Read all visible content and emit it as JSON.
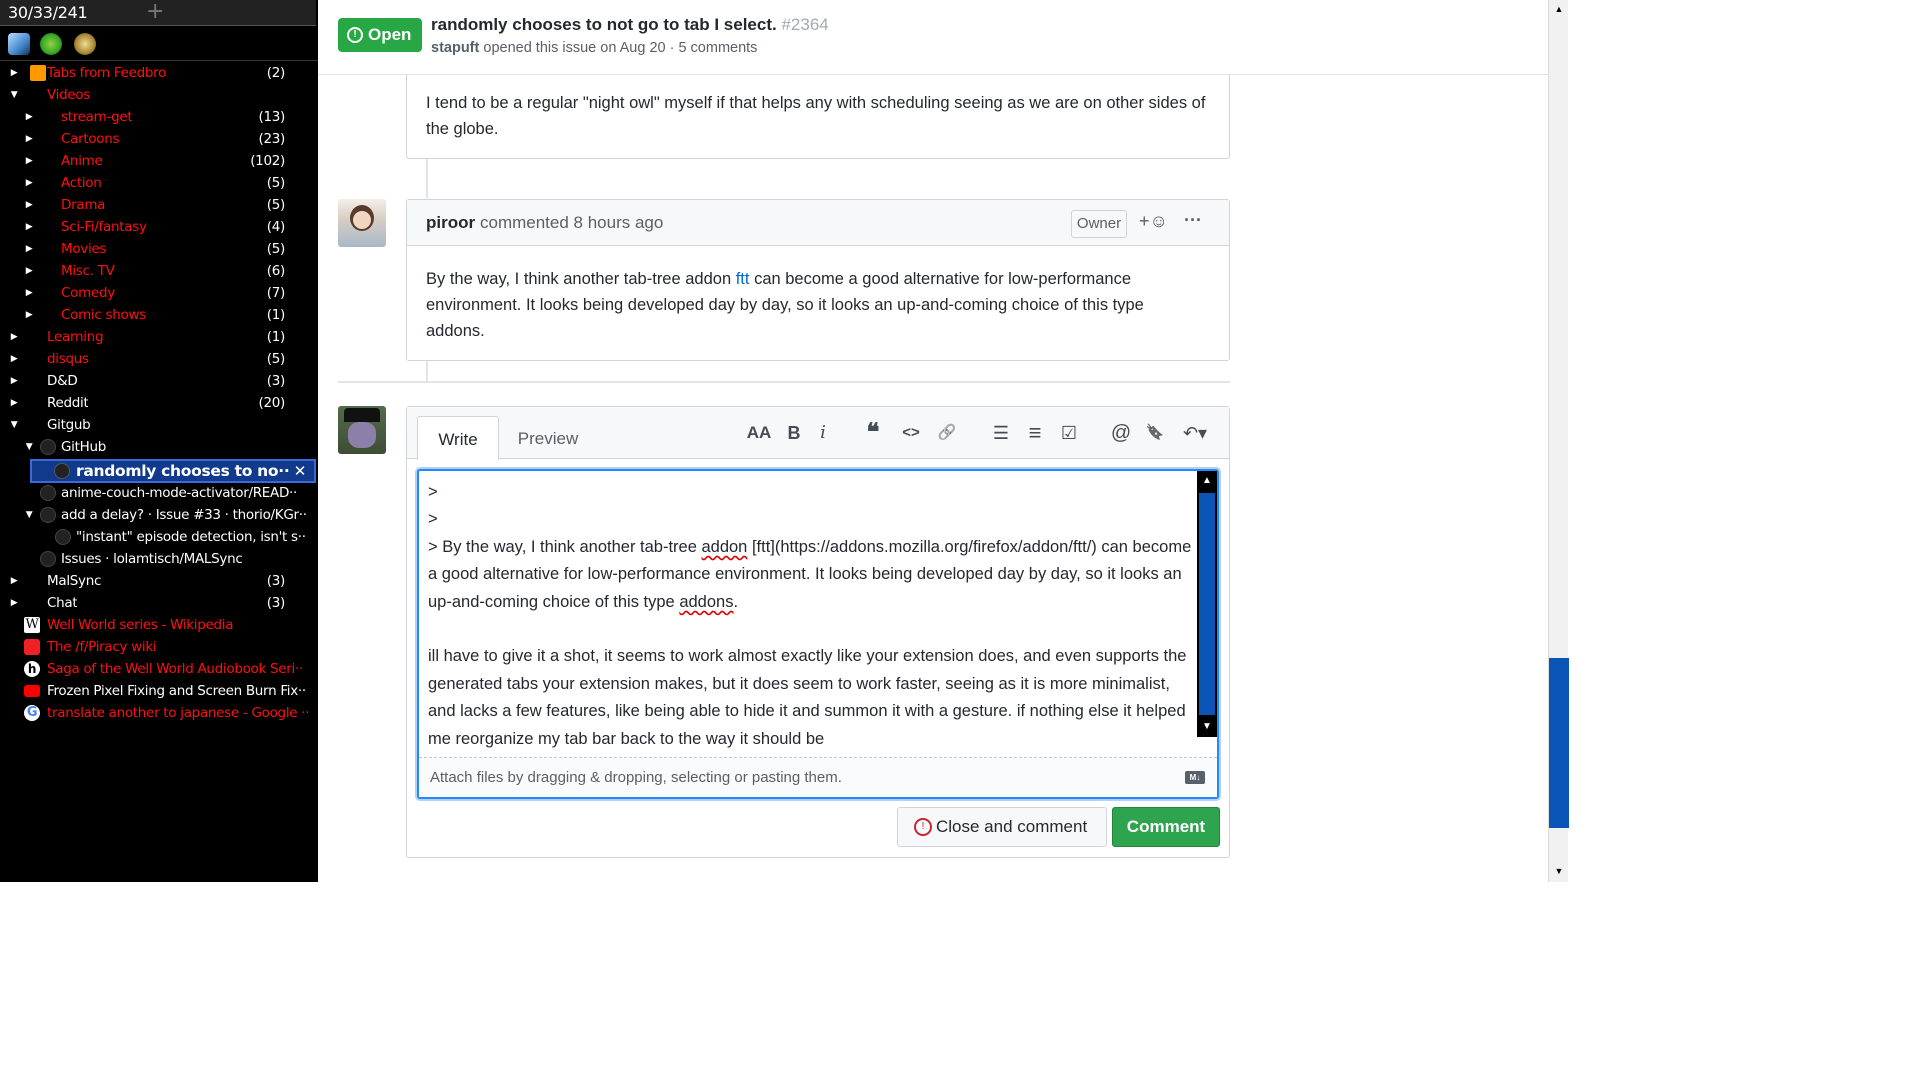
{
  "sidebar": {
    "count": "30/33/241",
    "plus": "+",
    "tree": [
      {
        "label": "Tabs from Feedbro",
        "count": "(2)"
      },
      {
        "label": "Videos",
        "count": ""
      },
      {
        "label": "stream-get",
        "count": "(13)"
      },
      {
        "label": "Cartoons",
        "count": "(23)"
      },
      {
        "label": "Anime",
        "count": "(102)"
      },
      {
        "label": "Action",
        "count": "(5)"
      },
      {
        "label": "Drama",
        "count": "(5)"
      },
      {
        "label": "Sci-Fi/fantasy",
        "count": "(4)"
      },
      {
        "label": "Movies",
        "count": "(5)"
      },
      {
        "label": "Misc. TV",
        "count": "(6)"
      },
      {
        "label": "Comedy",
        "count": "(7)"
      },
      {
        "label": "Comic shows",
        "count": "(1)"
      },
      {
        "label": "Learning",
        "count": "(1)"
      },
      {
        "label": "disqus",
        "count": "(5)"
      },
      {
        "label": "D&D",
        "count": "(3)"
      },
      {
        "label": "Reddit",
        "count": "(20)"
      },
      {
        "label": "Gitgub",
        "count": ""
      },
      {
        "label": "GitHub",
        "count": ""
      },
      {
        "label": "randomly chooses to no··",
        "count": ""
      },
      {
        "label": "anime-couch-mode-activator/READ··",
        "count": ""
      },
      {
        "label": "add a delay? · Issue #33 · thorio/KGr··",
        "count": ""
      },
      {
        "label": "\"instant\" episode detection, isn't s··",
        "count": ""
      },
      {
        "label": "Issues · lolamtisch/MALSync",
        "count": ""
      },
      {
        "label": "MalSync",
        "count": "(3)"
      },
      {
        "label": "Chat",
        "count": "(3)"
      },
      {
        "label": "Well World series - Wikipedia",
        "count": ""
      },
      {
        "label": "The /f/Piracy wiki",
        "count": ""
      },
      {
        "label": "Saga of the Well World Audiobook Seri··",
        "count": ""
      },
      {
        "label": "Frozen Pixel Fixing and Screen Burn Fix··",
        "count": ""
      },
      {
        "label": "translate another to japanese - Google ··",
        "count": ""
      }
    ],
    "close_glyph": "✕"
  },
  "issue": {
    "status": "Open",
    "title": "randomly chooses to not go to tab I select.",
    "number": "#2364",
    "author": "stapuft",
    "meta_rest": "opened this issue on Aug 20 · 5 comments"
  },
  "comment1": {
    "text": "I tend to be a regular \"night owl\" myself if that helps any with scheduling seeing as we are on other sides of the globe."
  },
  "comment2": {
    "author": "piroor",
    "action": "commented 8 hours ago",
    "badge": "Owner",
    "reaction": "+☺",
    "more": "···",
    "text_before": "By the way, I think another tab-tree addon ",
    "link": "ftt",
    "text_after": " can become a good alternative for low-performance environment. It looks being developed day by day, so it looks an up-and-coming choice of this type addons."
  },
  "editor": {
    "tab_write": "Write",
    "tab_preview": "Preview",
    "toolbar": {
      "heading": "AA",
      "bold": "B",
      "italic": "i",
      "quote": "❝",
      "code": "<>",
      "link": "🔗",
      "ul": "☰",
      "ol": "≡",
      "task": "☑",
      "mention": "@",
      "bookmark": "🔖",
      "reply": "↶▾"
    },
    "line1": ">",
    "line2": ">",
    "line3_a": "> By the way, I think another tab-tree ",
    "line3_addon": "addon",
    "line3_b": " [ftt](https://addons.mozilla.org/firefox/addon/ftt/) can become a good alternative for low-performance environment. It looks being developed day by day, so it looks an up-and-coming choice of this type ",
    "line3_addons": "addons",
    "line3_c": ".",
    "para2": "ill have to give it a shot, it seems to work almost exactly like your extension does, and even supports the generated tabs your extension makes, but it does seem to work faster, seeing as it is more minimalist, and lacks a few features, like being able to hide it and summon it with a gesture. if nothing else it helped me reorganize my tab bar back to the way it should be",
    "attach": "Attach files by dragging & dropping, selecting or pasting them.",
    "md": "M↓",
    "close_btn": "Close and comment",
    "comment_btn": "Comment"
  },
  "colors": {
    "open_green": "#28a745",
    "sidebar_red": "#ff1010",
    "selected_bg": "#123a8c",
    "link_blue": "#0366d6"
  }
}
